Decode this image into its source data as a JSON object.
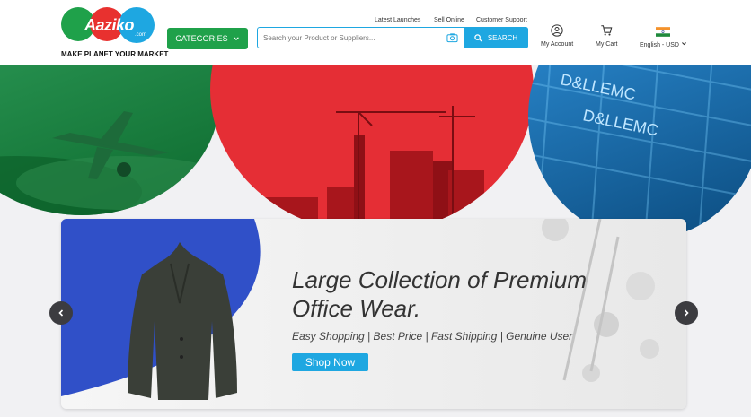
{
  "brand": {
    "name": "Aaziko",
    "dotcom": ".com",
    "tagline": "MAKE PLANET YOUR MARKET"
  },
  "header": {
    "categories_label": "CATEGORIES",
    "top_links": [
      "Latest Launches",
      "Sell Online",
      "Customer Support"
    ],
    "search_placeholder": "Search your Product or Suppliers...",
    "search_button": "SEARCH",
    "account_label": "My Account",
    "cart_label": "My Cart",
    "locale_label": "English - USD"
  },
  "hero": {
    "headline_line1": "Large Collection of Premium",
    "headline_line2": "Office Wear.",
    "subtitle": "Easy Shopping | Best Price | Fast Shipping | Genuine User",
    "cta_label": "Shop Now",
    "banner_image_text": "D&LLEMC"
  },
  "colors": {
    "green": "#1fa14a",
    "red": "#e8312f",
    "blue": "#1ea7e1",
    "dark": "#3c3c40"
  },
  "icons": [
    "chevron-down-icon",
    "camera-icon",
    "search-icon",
    "user-icon",
    "cart-icon",
    "india-flag-icon",
    "chevron-left-icon",
    "chevron-right-icon"
  ]
}
